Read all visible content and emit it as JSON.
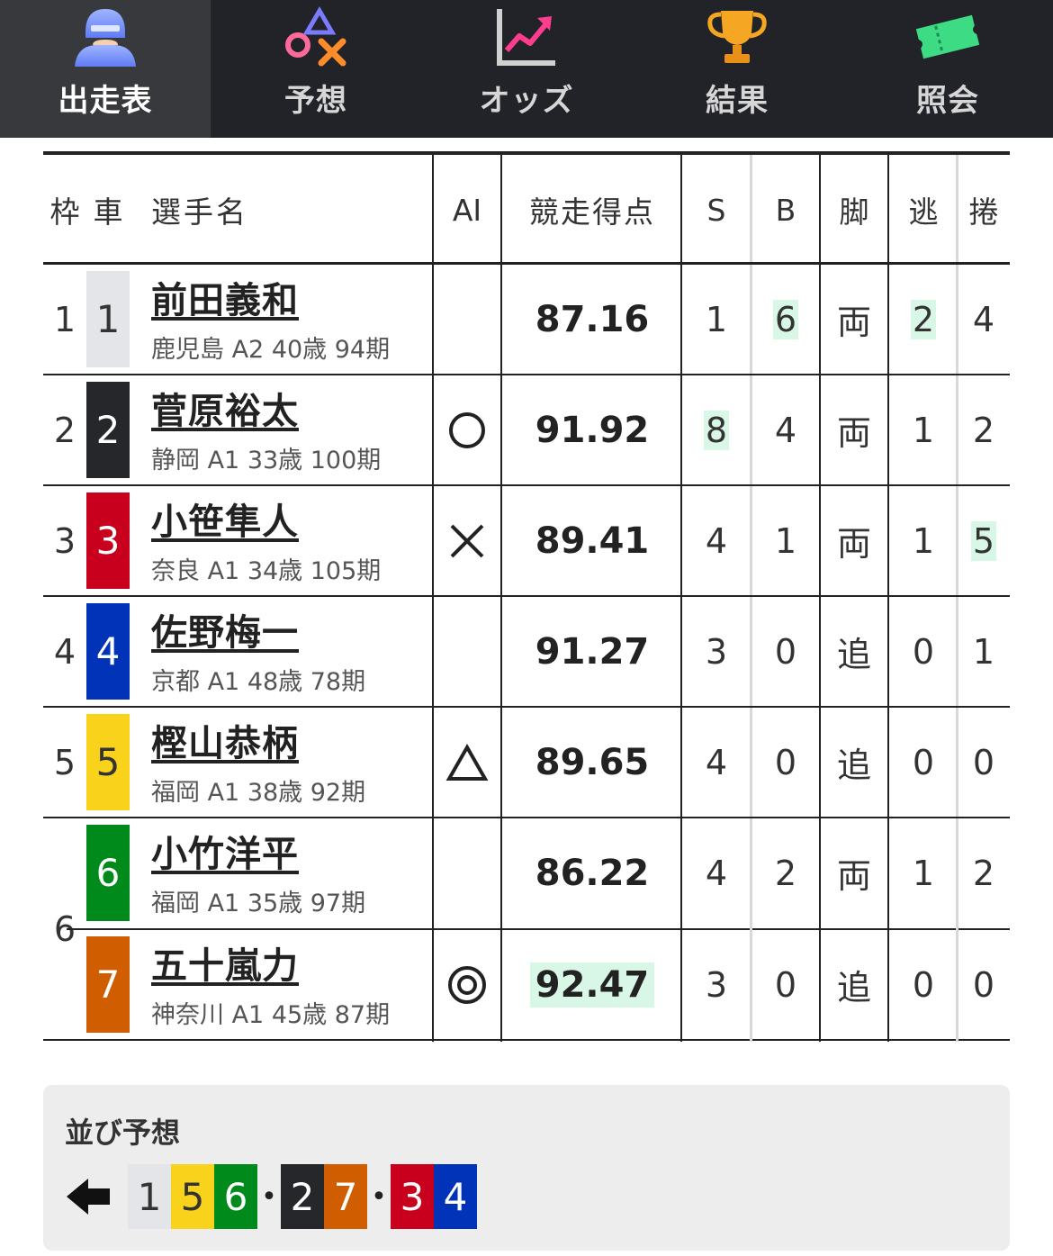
{
  "nav": {
    "tabs": [
      {
        "label": "出走表",
        "icon": "racer-helmet-icon",
        "active": true
      },
      {
        "label": "予想",
        "icon": "prediction-symbols-icon",
        "active": false
      },
      {
        "label": "オッズ",
        "icon": "odds-chart-icon",
        "active": false
      },
      {
        "label": "結果",
        "icon": "trophy-icon",
        "active": false
      },
      {
        "label": "照会",
        "icon": "ticket-icon",
        "active": false
      }
    ]
  },
  "table": {
    "headers": {
      "waku": "枠",
      "car": "車",
      "name": "選手名",
      "ai": "AI",
      "score": "競走得点",
      "s": "S",
      "b": "B",
      "kyaku": "脚",
      "nige": "逃",
      "sashi": "捲"
    },
    "rows": [
      {
        "waku": "1",
        "car": "1",
        "name": "前田義和",
        "sub": "鹿児島 A2 40歳 94期",
        "ai": "",
        "score": "87.16",
        "s": "1",
        "b": "6",
        "kyaku": "両",
        "nige": "2",
        "sashi": "4"
      },
      {
        "waku": "2",
        "car": "2",
        "name": "菅原裕太",
        "sub": "静岡 A1 33歳 100期",
        "ai": "○",
        "score": "91.92",
        "s": "8",
        "b": "4",
        "kyaku": "両",
        "nige": "1",
        "sashi": "2"
      },
      {
        "waku": "3",
        "car": "3",
        "name": "小笹隼人",
        "sub": "奈良 A1 34歳 105期",
        "ai": "×",
        "score": "89.41",
        "s": "4",
        "b": "1",
        "kyaku": "両",
        "nige": "1",
        "sashi": "5"
      },
      {
        "waku": "4",
        "car": "4",
        "name": "佐野梅一",
        "sub": "京都 A1 48歳 78期",
        "ai": "",
        "score": "91.27",
        "s": "3",
        "b": "0",
        "kyaku": "追",
        "nige": "0",
        "sashi": "1"
      },
      {
        "waku": "5",
        "car": "5",
        "name": "樫山恭柄",
        "sub": "福岡 A1 38歳 92期",
        "ai": "△",
        "score": "89.65",
        "s": "4",
        "b": "0",
        "kyaku": "追",
        "nige": "0",
        "sashi": "0"
      },
      {
        "waku": "6",
        "car": "6",
        "name": "小竹洋平",
        "sub": "福岡 A1 35歳 97期",
        "ai": "",
        "score": "86.22",
        "s": "4",
        "b": "2",
        "kyaku": "両",
        "nige": "1",
        "sashi": "2"
      },
      {
        "waku": "6",
        "car": "7",
        "name": "五十嵐力",
        "sub": "神奈川 A1 45歳 87期",
        "ai": "◎",
        "score": "92.47",
        "s": "3",
        "b": "0",
        "kyaku": "追",
        "nige": "0",
        "sashi": "0"
      }
    ]
  },
  "prediction": {
    "title": "並び予想",
    "groups": [
      [
        "1",
        "5",
        "6"
      ],
      [
        "2",
        "7"
      ],
      [
        "3",
        "4"
      ]
    ],
    "separator": "•"
  },
  "colors": {
    "car_bg": {
      "1": "#e4e5e8",
      "2": "#26272b",
      "3": "#c8001e",
      "4": "#0033b8",
      "5": "#f9d21c",
      "6": "#008a1b",
      "7": "#d05e00"
    },
    "car_fg": {
      "1": "#333333",
      "2": "#ffffff",
      "3": "#ffffff",
      "4": "#ffffff",
      "5": "#333333",
      "6": "#ffffff",
      "7": "#ffffff"
    },
    "highlight": "#d9f7e6"
  }
}
